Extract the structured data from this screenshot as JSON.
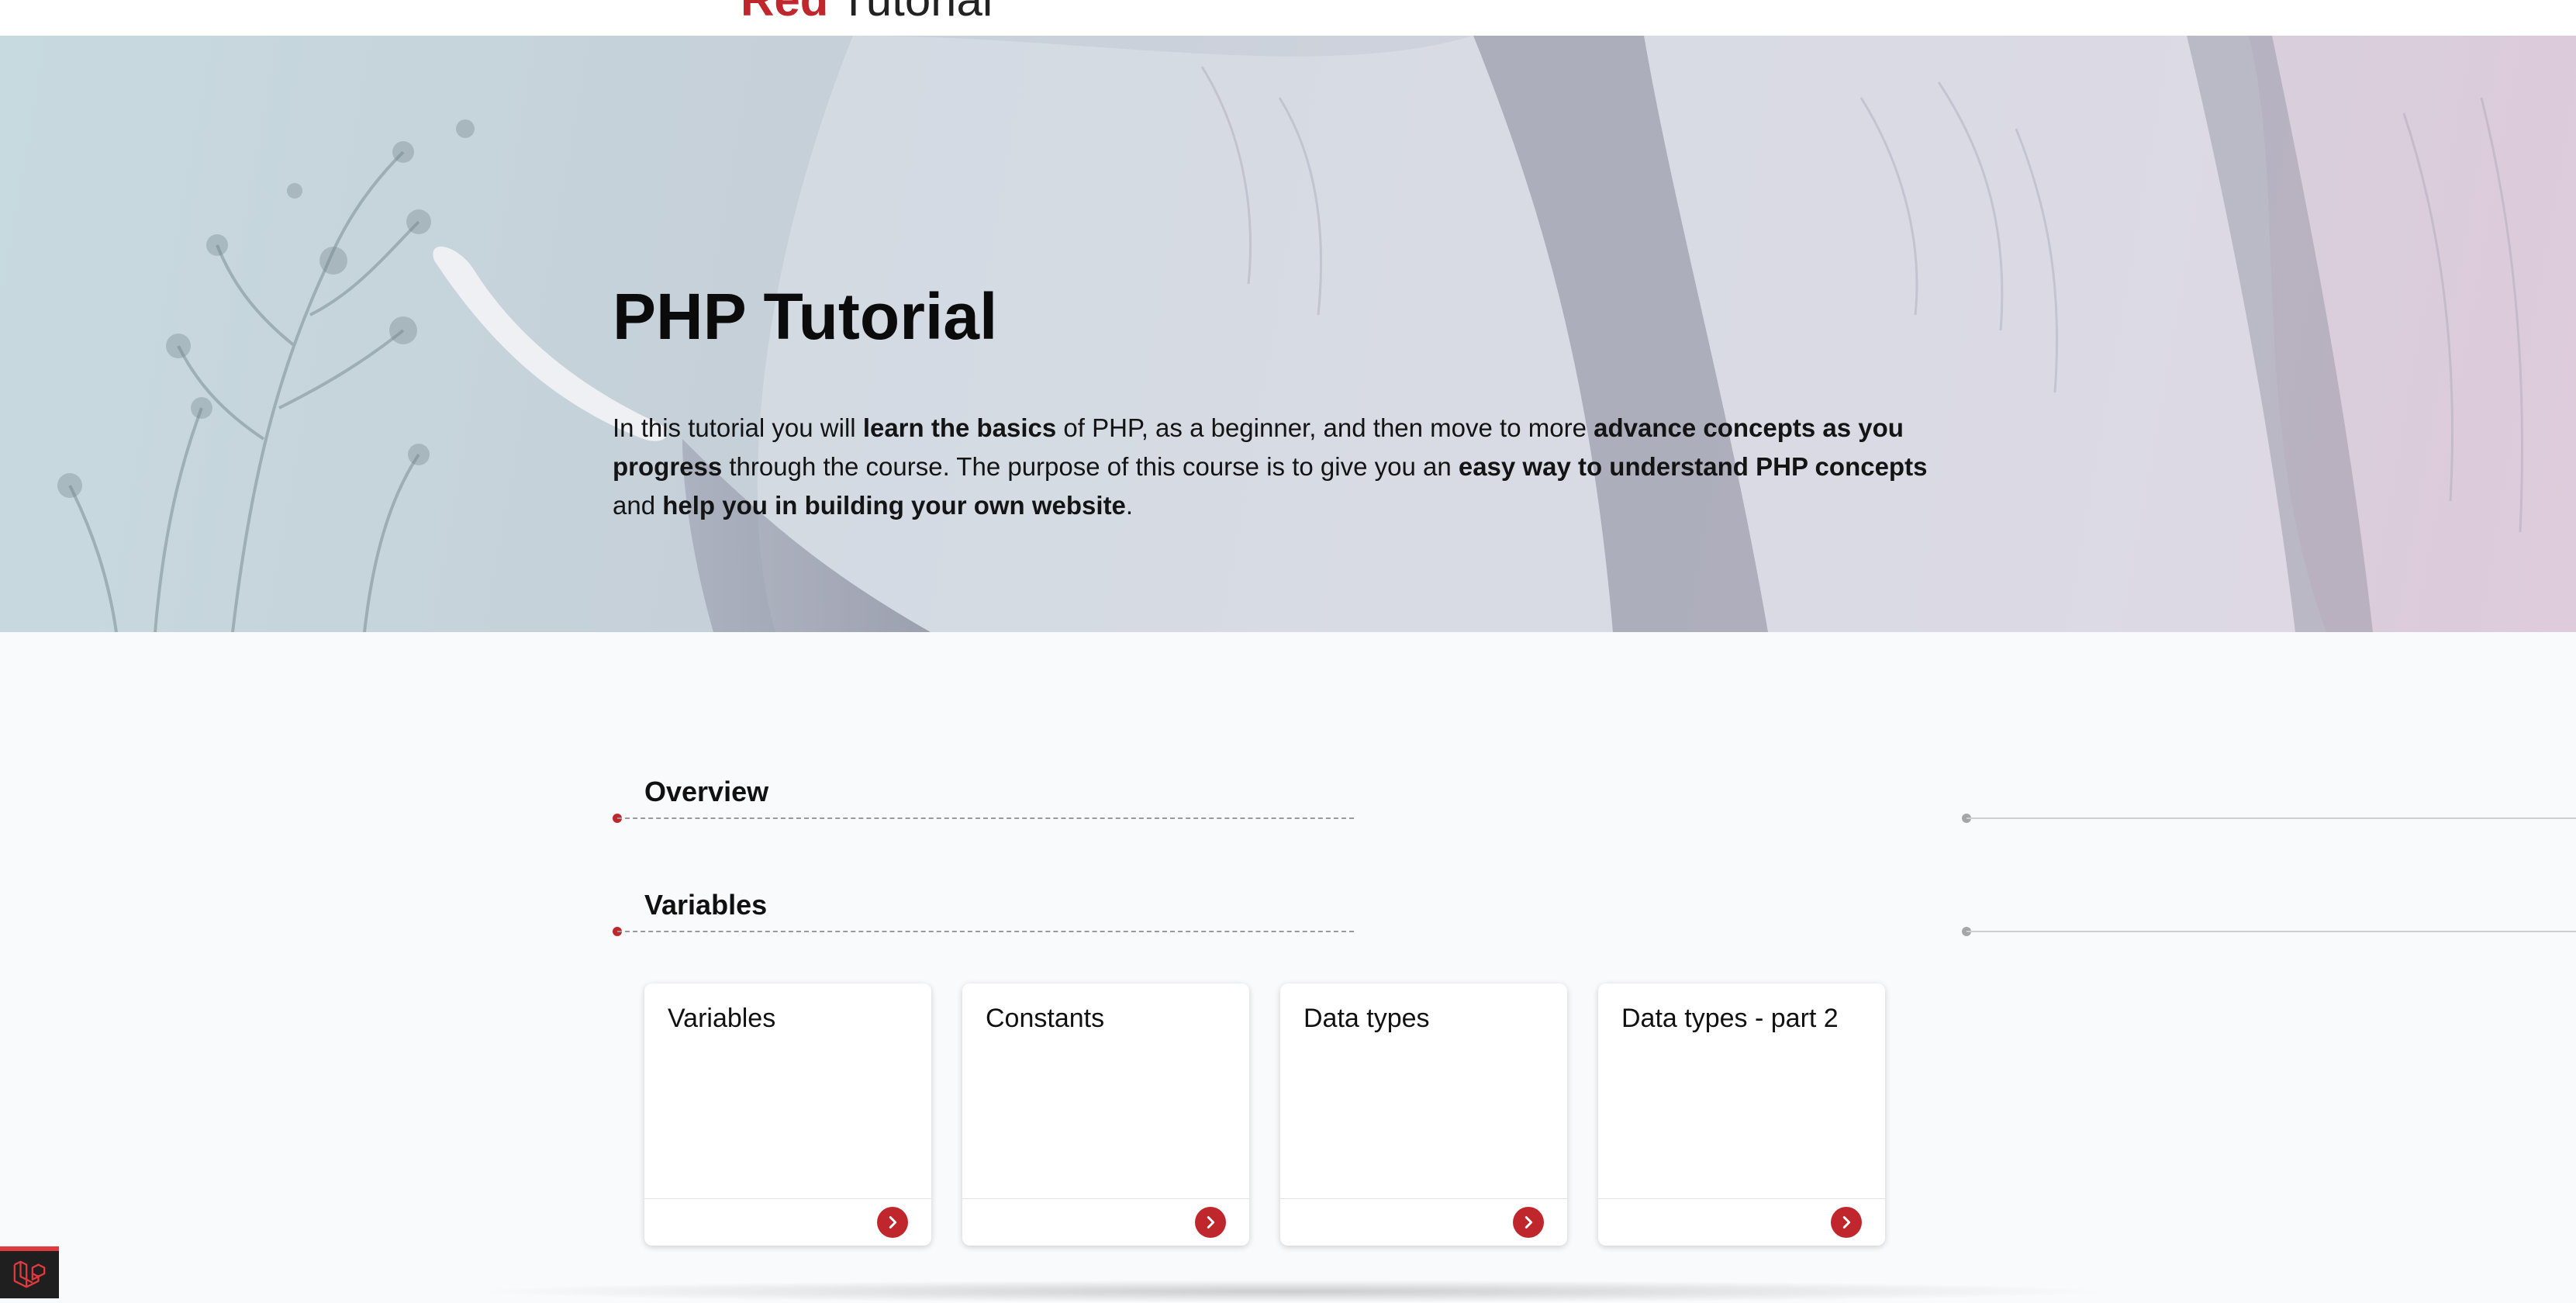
{
  "header": {
    "brand_red": "Red",
    "brand_rest": "Tutorial"
  },
  "hero": {
    "title": "PHP Tutorial",
    "intro": [
      {
        "text": "In this tutorial you will ",
        "bold": false
      },
      {
        "text": "learn the basics",
        "bold": true
      },
      {
        "text": " of PHP, as a beginner, and then move to more ",
        "bold": false
      },
      {
        "text": "advance concepts as you progress",
        "bold": true
      },
      {
        "text": " through the course. The purpose of this course is to give you an ",
        "bold": false
      },
      {
        "text": "easy way to understand PHP concepts",
        "bold": true
      },
      {
        "text": " and ",
        "bold": false
      },
      {
        "text": "help you  in building your own website",
        "bold": true
      },
      {
        "text": ".",
        "bold": false
      }
    ]
  },
  "sections": [
    {
      "title": "Overview"
    },
    {
      "title": "Variables"
    }
  ],
  "cards": [
    {
      "title": "Variables"
    },
    {
      "title": "Constants"
    },
    {
      "title": "Data types"
    },
    {
      "title": "Data types - part 2"
    }
  ],
  "colors": {
    "accent": "#c0272d",
    "badge_bg": "#1f1f1f"
  },
  "icons": {
    "card_button": "chevron-right-circle-icon",
    "corner_badge": "laravel-logo-icon"
  }
}
